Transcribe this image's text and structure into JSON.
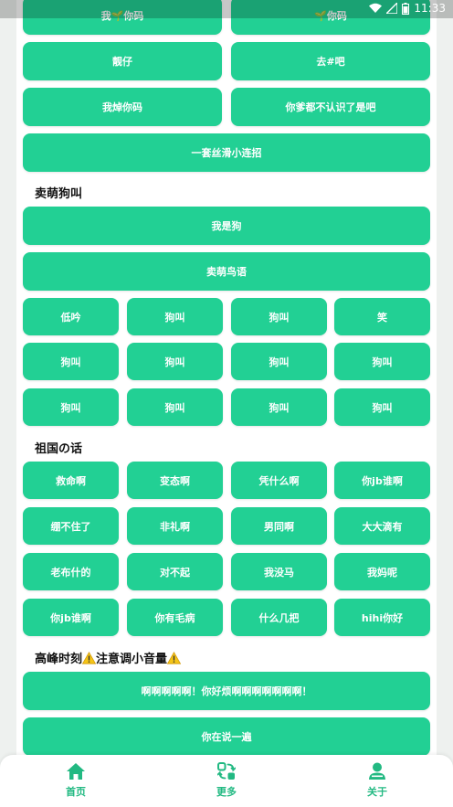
{
  "status_bar": {
    "time": "11:33"
  },
  "top_buttons": [
    {
      "label": "我🌱你码"
    },
    {
      "label": "🌱你码"
    },
    {
      "label": "靓仔"
    },
    {
      "label": "去#吧"
    },
    {
      "label": "我焯你码"
    },
    {
      "label": "你爹都不认识了是吧"
    },
    {
      "label": "一套丝滑小连招"
    }
  ],
  "section_dog": {
    "title": "卖萌狗叫",
    "wide_buttons": [
      {
        "label": "我是狗"
      },
      {
        "label": "卖萌鸟语"
      }
    ],
    "grid_buttons": [
      {
        "label": "低吟"
      },
      {
        "label": "狗叫"
      },
      {
        "label": "狗叫"
      },
      {
        "label": "笑"
      },
      {
        "label": "狗叫"
      },
      {
        "label": "狗叫"
      },
      {
        "label": "狗叫"
      },
      {
        "label": "狗叫"
      },
      {
        "label": "狗叫"
      },
      {
        "label": "狗叫"
      },
      {
        "label": "狗叫"
      },
      {
        "label": "狗叫"
      }
    ]
  },
  "section_motherland": {
    "title": "祖国の话",
    "grid_buttons": [
      {
        "label": "救命啊"
      },
      {
        "label": "变态啊"
      },
      {
        "label": "凭什么啊"
      },
      {
        "label": "你jb谁啊"
      },
      {
        "label": "绷不住了"
      },
      {
        "label": "非礼啊"
      },
      {
        "label": "男同啊"
      },
      {
        "label": "大大滴有"
      },
      {
        "label": "老布什的"
      },
      {
        "label": "对不起"
      },
      {
        "label": "我没马"
      },
      {
        "label": "我妈呢"
      },
      {
        "label": "你jb谁啊"
      },
      {
        "label": "你有毛病"
      },
      {
        "label": "什么几把"
      },
      {
        "label": "hihi你好"
      }
    ]
  },
  "section_peak": {
    "title_part1": "高峰时刻",
    "title_part2": "注意调小音量",
    "wide_buttons": [
      {
        "label": "啊啊啊啊啊！你好烦啊啊啊啊啊啊啊！"
      },
      {
        "label": "你在说一遍"
      }
    ]
  },
  "bottom_nav": {
    "items": [
      {
        "label": "首页"
      },
      {
        "label": "更多"
      },
      {
        "label": "关于"
      }
    ]
  },
  "colors": {
    "accent": "#22d094",
    "nav_accent": "#22b982"
  }
}
